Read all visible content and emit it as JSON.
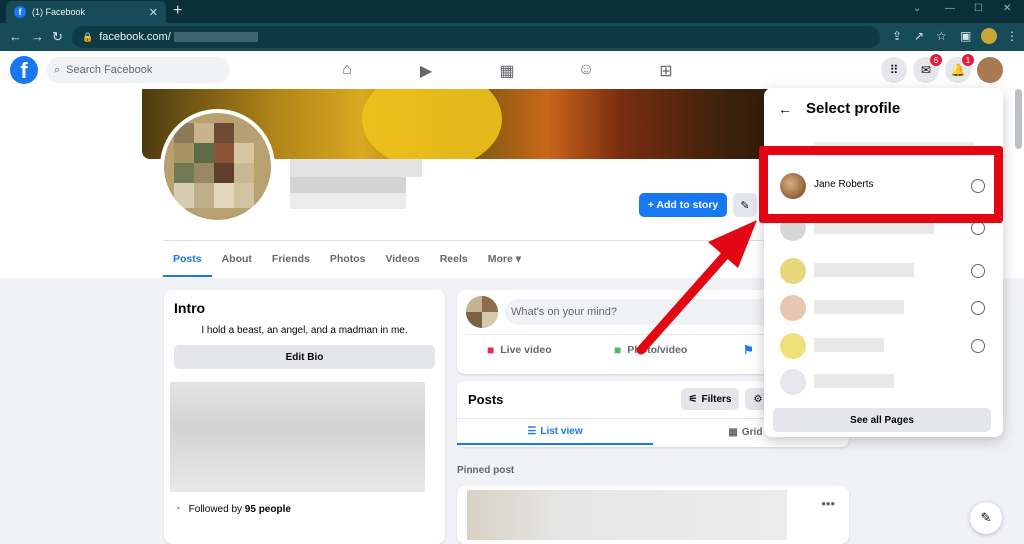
{
  "browser": {
    "tab_title": "(1) Facebook",
    "tab_close": "✕",
    "new_tab": "+",
    "url": "facebook.com/",
    "window_controls": [
      "⌄",
      "—",
      "☐",
      "✕"
    ]
  },
  "header": {
    "search_placeholder": "Search Facebook",
    "messenger_badge": "6",
    "notifications_badge": "1"
  },
  "profile": {
    "add_to_story": "+ Add to story",
    "tabs": [
      "Posts",
      "About",
      "Friends",
      "Photos",
      "Videos",
      "Reels",
      "More ▾"
    ]
  },
  "intro": {
    "title": "Intro",
    "bio": "I hold a beast, an angel, and a madman in me.",
    "edit_bio": "Edit Bio",
    "followed_prefix": "Followed by ",
    "followed_count": "95 people"
  },
  "composer": {
    "placeholder": "What's on your mind?",
    "live_video": "Live video",
    "photo_video": "Photo/video"
  },
  "posts": {
    "title": "Posts",
    "filters": "Filters",
    "list_view": "List view",
    "grid_view": "Grid vi",
    "pinned_label": "Pinned post"
  },
  "dropdown": {
    "title": "Select profile",
    "profile_name": "Jane Roberts",
    "see_all": "See all Pages"
  },
  "colors": {
    "brand": "#1877f2",
    "highlight": "#e30613",
    "chrome_frame": "#0b2f3a"
  }
}
